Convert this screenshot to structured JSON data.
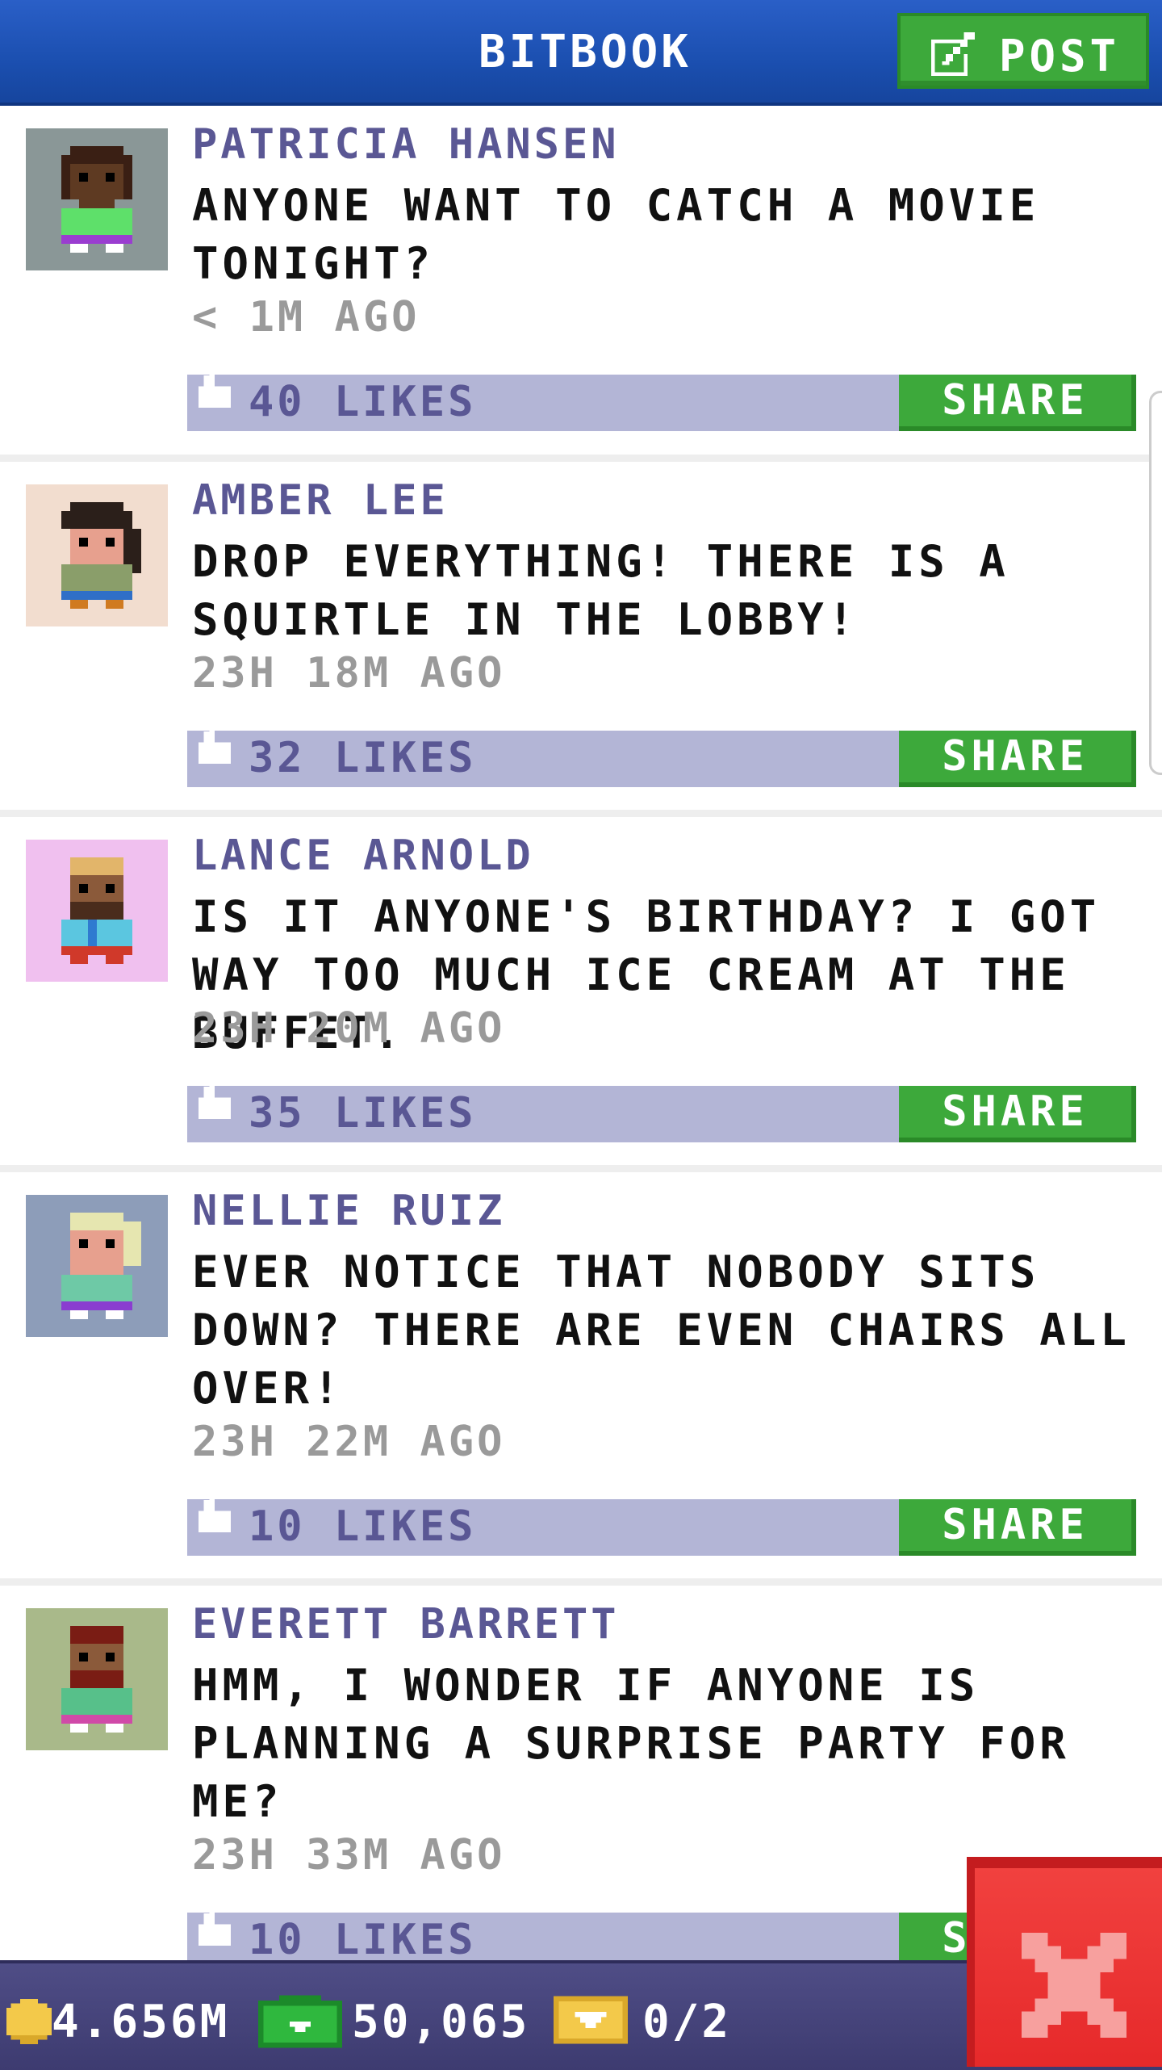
{
  "header": {
    "title": "BITBOOK",
    "post_label": "POST"
  },
  "posts": [
    {
      "author": "PATRICIA HANSEN",
      "message": "ANYONE WANT TO CATCH A MOVIE TONIGHT?",
      "time": "< 1M AGO",
      "likes": "40 LIKES",
      "share_label": "SHARE",
      "avatar_bg": "#8a9797"
    },
    {
      "author": "AMBER LEE",
      "message": "DROP EVERYTHING! THERE IS A SQUIRTLE IN THE LOBBY!",
      "time": "23H 18M AGO",
      "likes": "32 LIKES",
      "share_label": "SHARE",
      "avatar_bg": "#f2ddcf"
    },
    {
      "author": "LANCE ARNOLD",
      "message": "IS IT ANYONE'S BIRTHDAY? I GOT WAY TOO MUCH ICE CREAM AT THE BUFFET.",
      "time": "23H 20M AGO",
      "likes": "35 LIKES",
      "share_label": "SHARE",
      "avatar_bg": "#f0c0ef"
    },
    {
      "author": "NELLIE RUIZ",
      "message": "EVER NOTICE THAT NOBODY SITS DOWN? THERE ARE EVEN CHAIRS ALL OVER!",
      "time": "23H 22M AGO",
      "likes": "10 LIKES",
      "share_label": "SHARE",
      "avatar_bg": "#8d9db9"
    },
    {
      "author": "EVERETT BARRETT",
      "message": "HMM, I WONDER IF ANYONE IS PLANNING A SURPRISE PARTY FOR ME?",
      "time": "23H 33M AGO",
      "likes": "10 LIKES",
      "share_label": "SHARE",
      "avatar_bg": "#a9b98a"
    }
  ],
  "currency": {
    "coins": "4.656M",
    "bux": "50,065",
    "tickets": "0/2"
  },
  "icons": {
    "post": "edit-icon",
    "like": "thumbs-up-icon",
    "coin": "coin-icon",
    "bux": "bux-icon",
    "ticket": "ticket-icon",
    "close": "close-icon"
  },
  "colors": {
    "header": "#1b4fb0",
    "green_button": "#3da93b",
    "like_bar": "#b3b5d6",
    "author_text": "#5a5794",
    "close_button": "#e6292a",
    "bottom_bar": "#4a4880"
  }
}
